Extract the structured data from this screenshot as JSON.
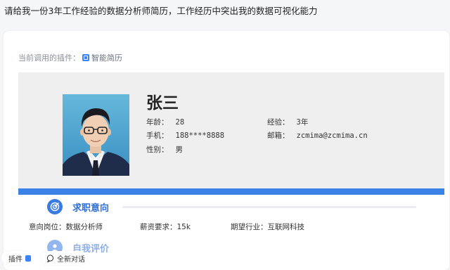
{
  "prompt": {
    "text": "请给我一份3年工作经验的数据分析师简历，工作经历中突出我的数据可视化能力"
  },
  "plugin": {
    "label": "当前调用的插件：",
    "name": "智能简历",
    "icon": "resume-plugin-icon"
  },
  "resume": {
    "name": "张三",
    "info": {
      "age_label": "年龄：",
      "age": "28",
      "experience_label": "经验：",
      "experience": "3年",
      "phone_label": "手机：",
      "phone": "188****8888",
      "email_label": "邮箱：",
      "email": "zcmima@zcmima.cn",
      "gender_label": "性别：",
      "gender": "男"
    },
    "sections": {
      "intent": {
        "title": "求职意向",
        "icon": "target-icon",
        "position_label": "意向岗位：",
        "position": "数据分析师",
        "salary_label": "薪资要求：",
        "salary": "15k",
        "industry_label": "期望行业：",
        "industry": "互联网科技"
      },
      "self_eval": {
        "title": "自我评价",
        "icon": "person-icon"
      }
    }
  },
  "bottom": {
    "plugin_label": "插件",
    "new_chat_label": "全新对话"
  },
  "colors": {
    "accent": "#3b82e6",
    "section_title": "#2f6fd6",
    "header_bg": "#efefef"
  }
}
